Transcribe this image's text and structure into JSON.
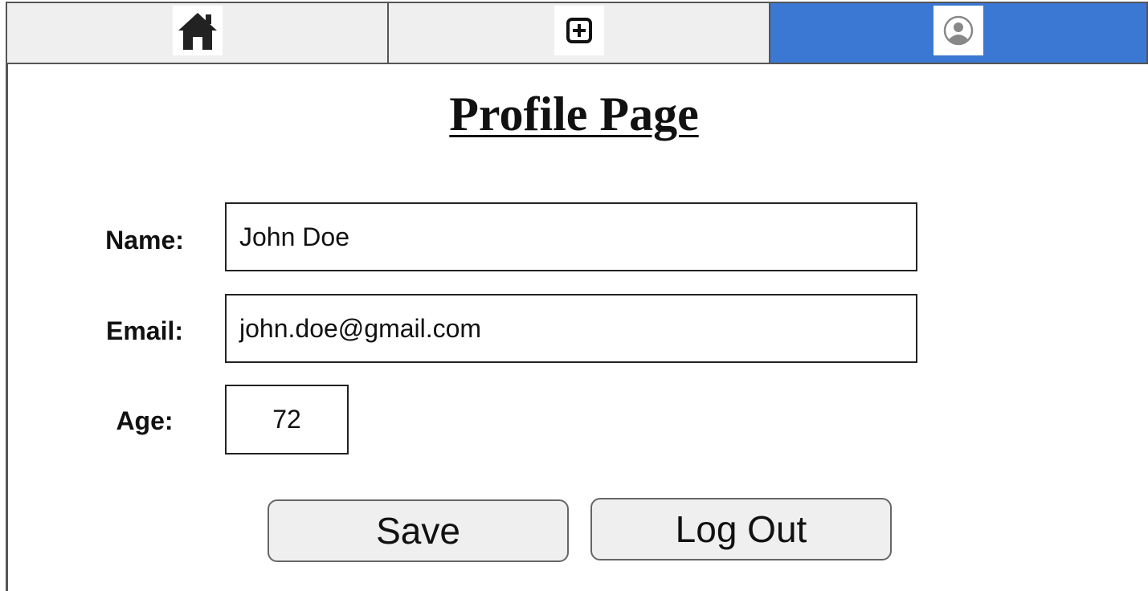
{
  "navbar": {
    "tabs": [
      {
        "name": "home",
        "icon": "home-icon",
        "active": false
      },
      {
        "name": "add",
        "icon": "plus-square-icon",
        "active": false
      },
      {
        "name": "profile",
        "icon": "user-circle-icon",
        "active": true
      }
    ],
    "accent_color": "#3b78d4",
    "inactive_color": "#efefef"
  },
  "page": {
    "title": "Profile Page"
  },
  "form": {
    "name": {
      "label": "Name:",
      "value": "John Doe"
    },
    "email": {
      "label": "Email:",
      "value": "john.doe@gmail.com"
    },
    "age": {
      "label": "Age:",
      "value": "72"
    }
  },
  "actions": {
    "save_label": "Save",
    "logout_label": "Log Out"
  }
}
